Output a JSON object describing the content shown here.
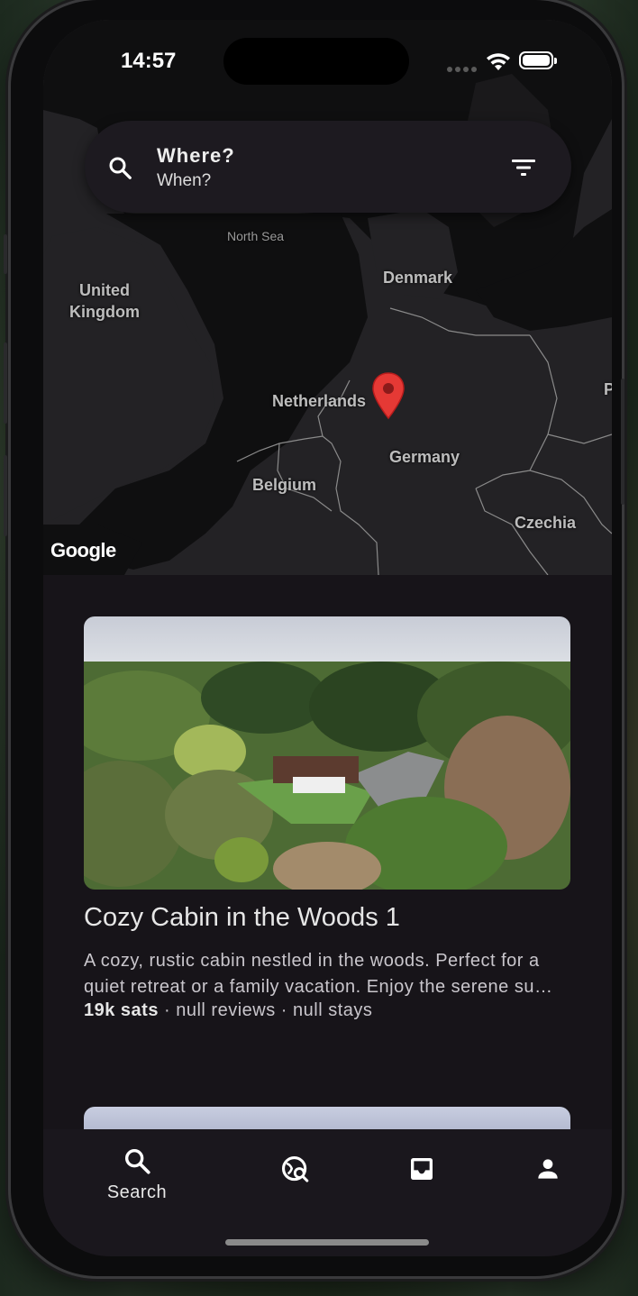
{
  "status_bar": {
    "time": "14:57"
  },
  "search": {
    "where": "Where?",
    "when": "When?"
  },
  "map": {
    "labels": {
      "north_sea": "North Sea",
      "uk": "United Kingdom",
      "denmark": "Denmark",
      "netherlands": "Netherlands",
      "germany": "Germany",
      "belgium": "Belgium",
      "czechia": "Czechia",
      "edge": "P"
    },
    "attribution": "Google",
    "pin_color": "#e53935"
  },
  "listing": {
    "title": "Cozy Cabin in the Woods 1",
    "description_line1": "A cozy, rustic cabin nestled in the woods. Perfect for a",
    "description_line2": "quiet retreat or a family vacation. Enjoy the serene su…",
    "price": "19k sats",
    "reviews": " · null reviews · null stays"
  },
  "bottom_nav": {
    "items": [
      {
        "label": "Search",
        "icon": "search-icon"
      },
      {
        "label": "",
        "icon": "travel-explore-icon"
      },
      {
        "label": "",
        "icon": "inbox-icon"
      },
      {
        "label": "",
        "icon": "person-icon"
      }
    ]
  },
  "colors": {
    "background": "#171419",
    "map": "#222123",
    "accent": "#e53935"
  }
}
